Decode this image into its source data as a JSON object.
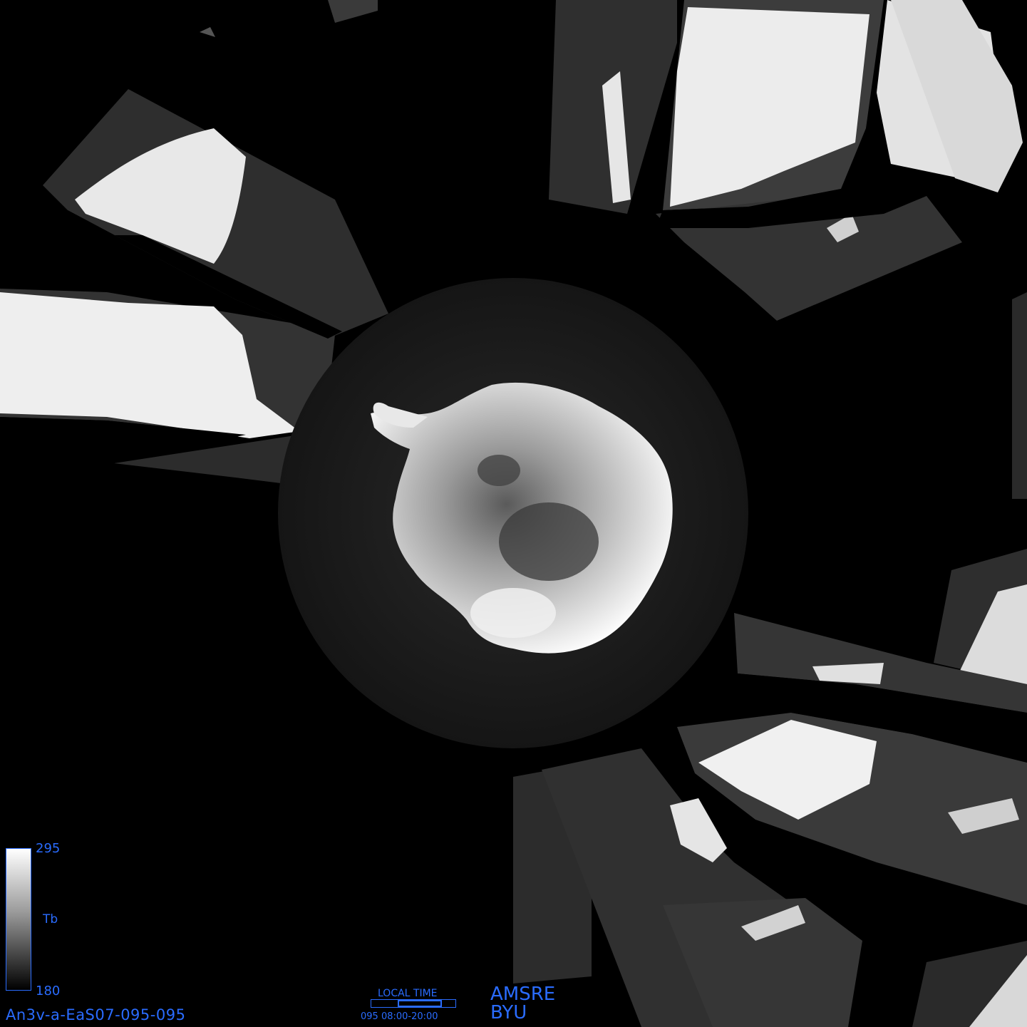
{
  "image": {
    "subject": "Antarctica polar stereographic brightness temperature mosaic",
    "colors": {
      "annotation": "#2a6cff",
      "background": "#000000"
    }
  },
  "colorbar": {
    "max": "295",
    "min": "180",
    "variable": "Tb",
    "gradient": [
      "#ffffff",
      "#000000"
    ]
  },
  "file_id": "An3v-a-EaS07-095-095",
  "local_time": {
    "title": "LOCAL TIME",
    "window": "095 08:00-20:00"
  },
  "sensor": {
    "instrument": "AMSRE",
    "institution": "BYU"
  }
}
